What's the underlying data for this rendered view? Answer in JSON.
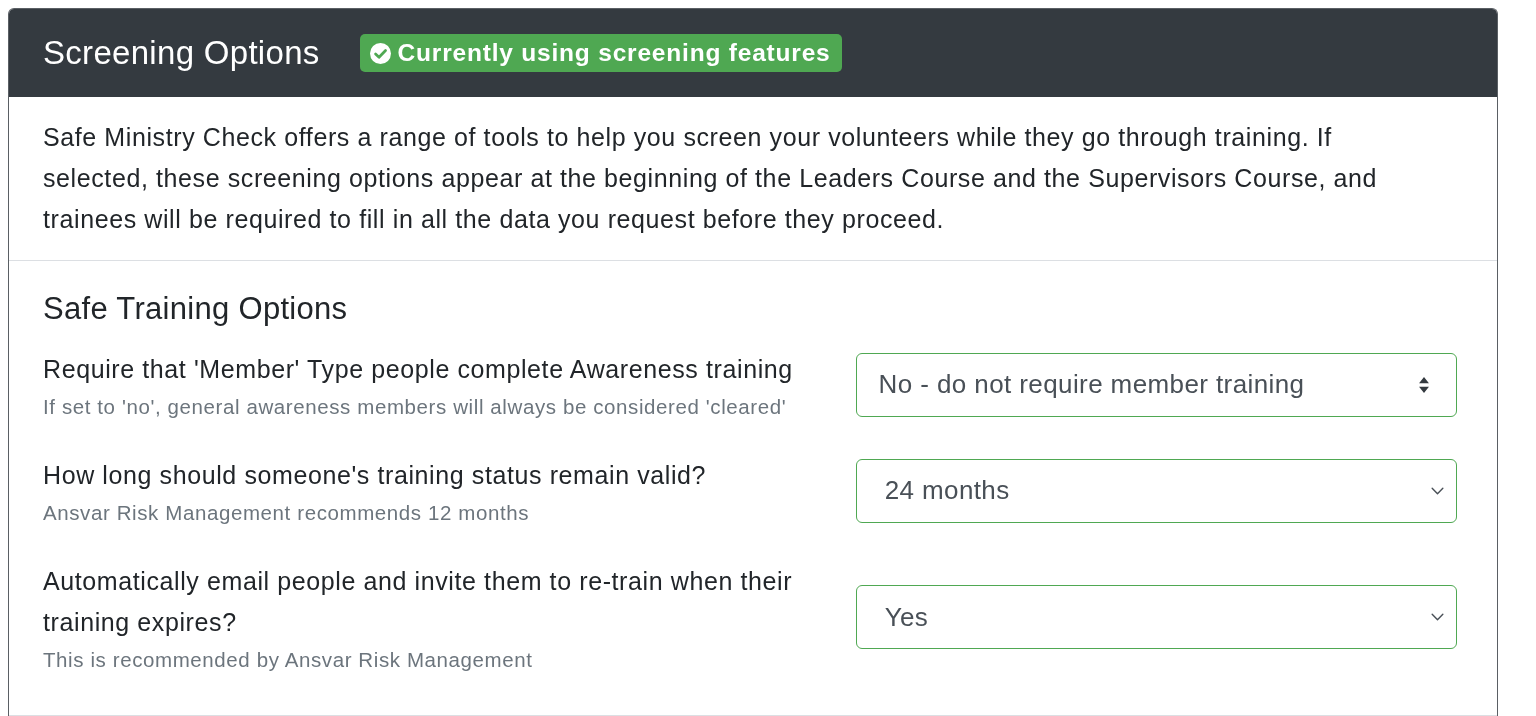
{
  "header": {
    "title": "Screening Options",
    "badge": {
      "text": "Currently using screening features",
      "active": true
    }
  },
  "intro": "Safe Ministry Check offers a range of tools to help you screen your volunteers while they go through training. If selected, these screening options appear at the beginning of the Leaders Course and the Supervisors Course, and trainees will be required to fill in all the data you request before they proceed.",
  "section": {
    "title": "Safe Training Options",
    "settings": [
      {
        "label": "Require that 'Member' Type people complete Awareness training",
        "help": "If set to 'no', general awareness members will always be considered 'cleared'",
        "select": {
          "kind": "custom",
          "value": "No - do not require member training",
          "valid": true
        }
      },
      {
        "label": "How long should someone's training status remain valid?",
        "help": "Ansvar Risk Management recommends 12 months",
        "select": {
          "kind": "native",
          "value": "24 months",
          "valid": true
        }
      },
      {
        "label": "Automatically email people and invite them to re-train when their training expires?",
        "help": "This is recommended by Ansvar Risk Management",
        "select": {
          "kind": "native",
          "value": "Yes",
          "valid": true
        }
      }
    ]
  }
}
